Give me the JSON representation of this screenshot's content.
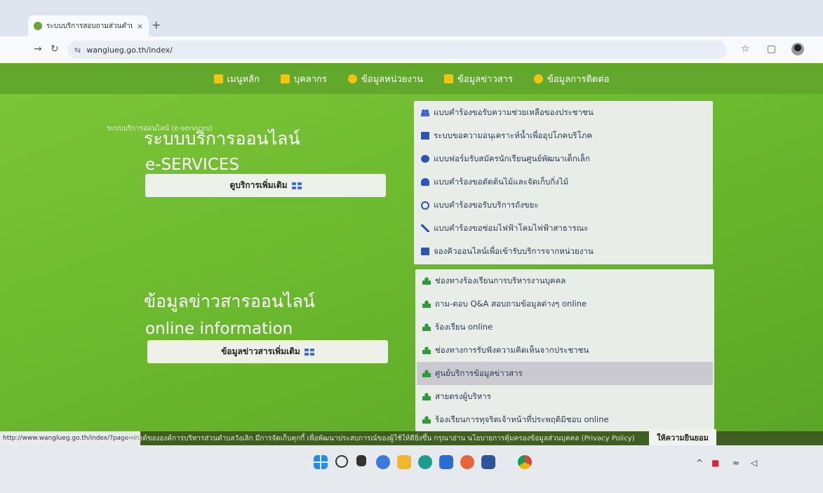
{
  "browser": {
    "tab_title": "ระบบบริการสอบถามส่วนตำบลวังเลิก อำเภอ",
    "tab_close": "×",
    "new_tab": "+",
    "url": "wanglueg.go.th/index/"
  },
  "nav": {
    "items": [
      {
        "label": "เมนูหลัก",
        "icon": "grid-icon"
      },
      {
        "label": "บุคลากร",
        "icon": "calendar-icon"
      },
      {
        "label": "ข้อมูลหน่วยงาน",
        "icon": "info-icon"
      },
      {
        "label": "ข้อมูลข่าวสาร",
        "icon": "chat-icon"
      },
      {
        "label": "ข้อมูลการติดต่อ",
        "icon": "phone-icon"
      }
    ]
  },
  "eservices": {
    "crumb": "ระบบบริการออนไลน์ (e-services)",
    "title_th": "ระบบบริการออนไลน์",
    "title_en": "e-SERVICES",
    "more_label": "ดูบริการเพิ่มเติม",
    "items": [
      {
        "label": "แบบคำร้องขอรับความช่วยเหลือของประชาชน",
        "icon": "users-icon"
      },
      {
        "label": "ระบบขอความอนุเคราะห์น้ำเพื่ออุปโภคบริโภค",
        "icon": "id-card-icon"
      },
      {
        "label": "แบบฟอร์มรับสมัครนักเรียนศูนย์พัฒนาเด็กเล็ก",
        "icon": "chat-icon"
      },
      {
        "label": "แบบคำร้องขอตัดต้นไม้และจัดเก็บกิ่งไม้",
        "icon": "bell-icon"
      },
      {
        "label": "แบบคำร้องขอรับบริการถังขยะ",
        "icon": "recycle-icon"
      },
      {
        "label": "แบบคำร้องขอซ่อมไฟฟ้าโคมไฟฟ้าสาธารณะ",
        "icon": "wrench-icon"
      },
      {
        "label": "จองคิวออนไลน์เพื่อเข้ารับบริการจากหน่วยงาน",
        "icon": "card-icon"
      }
    ]
  },
  "info": {
    "title_th": "ข้อมูลข่าวสารออนไลน์",
    "title_en": "online information",
    "more_label": "ข้อมูลข่าวสารเพิ่มเติม",
    "items": [
      {
        "label": "ช่องทางร้องเรียนการบริหารงานบุคคล"
      },
      {
        "label": "ถาม-ตอบ Q&A สอบถามข้อมูลต่างๆ online"
      },
      {
        "label": "ร้องเรียน online"
      },
      {
        "label": "ช่องทางการรับฟังความคิดเห็นจากประชาชน"
      },
      {
        "label": "ศูนย์บริการข้อมูลข่าวสาร",
        "highlighted": true
      },
      {
        "label": "สายตรงผู้บริหาร"
      },
      {
        "label": "ร้องเรียนการทุจริตเจ้าหน้าที่ประพฤติมิชอบ online"
      }
    ]
  },
  "cookie": {
    "text": "เว็บไซต์ขององค์การบริหารส่วนตำบลวังเลิก มีการจัดเก็บคุกกี้ เพื่อพัฒนาประสบการณ์ของผู้ใช้ให้ดียิ่งขึ้น กรุณาอ่าน นโยบายการคุ้มครองข้อมูลส่วนบุคคล (Privacy Policy)",
    "button": "ให้ความยินยอม",
    "status_url": "http://www.wanglueg.go.th/index/?page=in"
  }
}
